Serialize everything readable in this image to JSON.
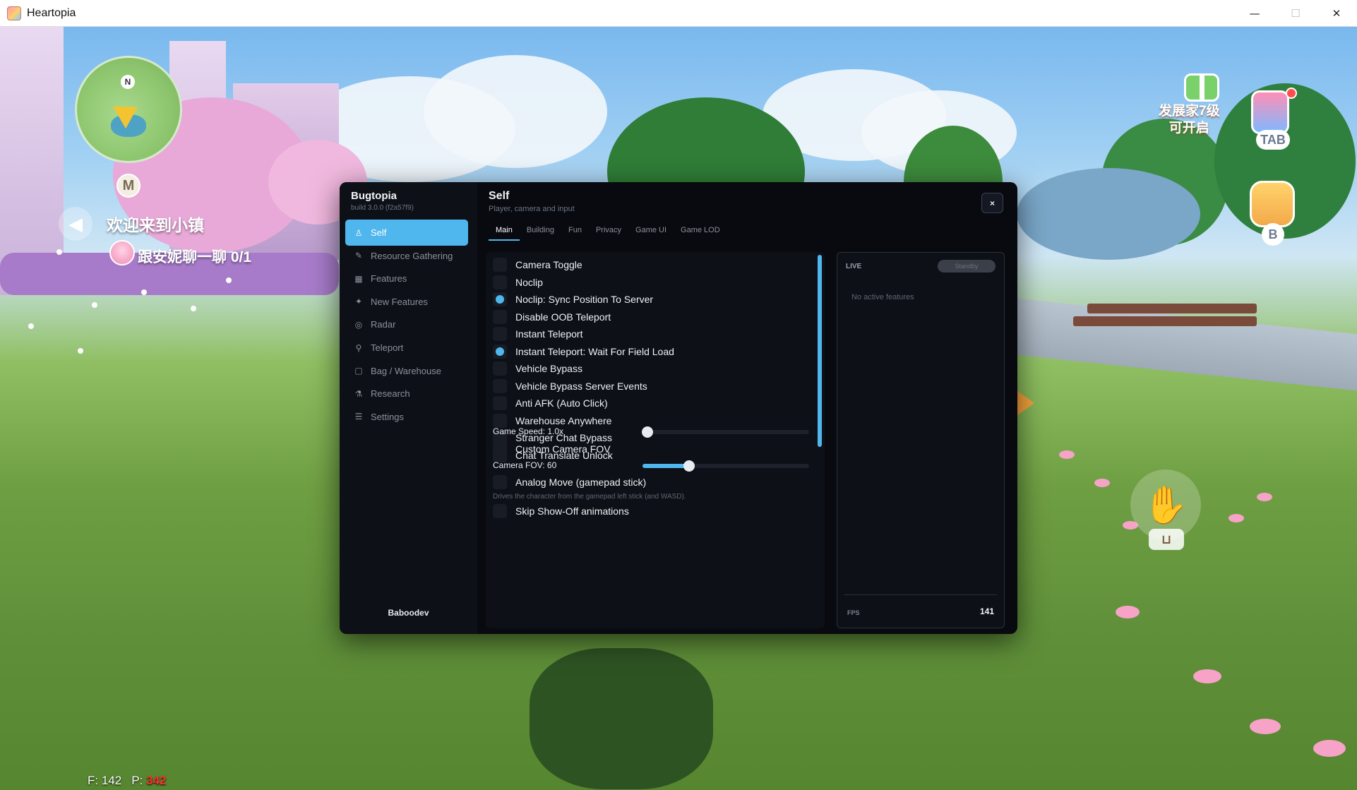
{
  "window": {
    "title": "Heartopia",
    "controls": {
      "minimize": "—",
      "maximize": "☐",
      "close": "✕"
    }
  },
  "hud": {
    "compass": "N",
    "map_key": "M",
    "welcome": "欢迎来到小镇",
    "task": "跟安妮聊一聊 0/1",
    "event": "发展家7级\n可开启",
    "tab_key": "TAB",
    "bag_key": "B",
    "sit_key": "⊔",
    "stats": {
      "f": "F: 142",
      "p_label": "P:",
      "p_value": "342"
    }
  },
  "menu": {
    "brand": "Bugtopia",
    "build": "build 3.0.0 (f2a57f9)",
    "footer_user": "Baboodev",
    "title": "Self",
    "subtitle": "Player, camera and input",
    "close_label": "×",
    "nav": [
      {
        "label": "Self",
        "icon": "person-icon",
        "glyph": "♙"
      },
      {
        "label": "Resource Gathering",
        "icon": "leaf-icon",
        "glyph": "✎"
      },
      {
        "label": "Features",
        "icon": "grid-icon",
        "glyph": "▦"
      },
      {
        "label": "New Features",
        "icon": "sparkle-icon",
        "glyph": "✦"
      },
      {
        "label": "Radar",
        "icon": "radar-icon",
        "glyph": "◎"
      },
      {
        "label": "Teleport",
        "icon": "pin-icon",
        "glyph": "⚲"
      },
      {
        "label": "Bag / Warehouse",
        "icon": "bag-icon",
        "glyph": "▢"
      },
      {
        "label": "Research",
        "icon": "flask-icon",
        "glyph": "⚗"
      },
      {
        "label": "Settings",
        "icon": "sliders-icon",
        "glyph": "☰"
      }
    ],
    "tabs": [
      "Main",
      "Building",
      "Fun",
      "Privacy",
      "Game UI",
      "Game LOD"
    ],
    "options": [
      {
        "label": "Camera Toggle",
        "on": false
      },
      {
        "label": "Noclip",
        "on": false
      },
      {
        "label": "Noclip: Sync Position To Server",
        "on": true
      },
      {
        "label": "Disable OOB Teleport",
        "on": false
      },
      {
        "label": "Instant Teleport",
        "on": false
      },
      {
        "label": "Instant Teleport: Wait For Field Load",
        "on": true
      },
      {
        "label": "Vehicle Bypass",
        "on": false
      },
      {
        "label": "Vehicle Bypass Server Events",
        "on": false
      },
      {
        "label": "Anti AFK (Auto Click)",
        "on": false
      },
      {
        "label": "Warehouse Anywhere",
        "on": false
      },
      {
        "label": "Stranger Chat Bypass",
        "on": false
      },
      {
        "label": "Chat Translate Unlock",
        "on": false
      }
    ],
    "game_speed": {
      "label": "Game Speed: 1.0x",
      "fraction": 0.03
    },
    "custom_fov": {
      "label": "Custom Camera FOV",
      "on": false
    },
    "camera_fov": {
      "label": "Camera FOV: 60",
      "fraction": 0.28
    },
    "analog_move": {
      "label": "Analog Move (gamepad stick)",
      "on": false,
      "hint": "Drives the character from the gamepad left stick (and WASD)."
    },
    "skin_show": {
      "label": "Skip Show-Off animations",
      "on": false
    },
    "live": {
      "title": "LIVE",
      "status": "Standby",
      "empty": "No active features",
      "fps_label": "FPS",
      "fps_value": "141"
    }
  }
}
